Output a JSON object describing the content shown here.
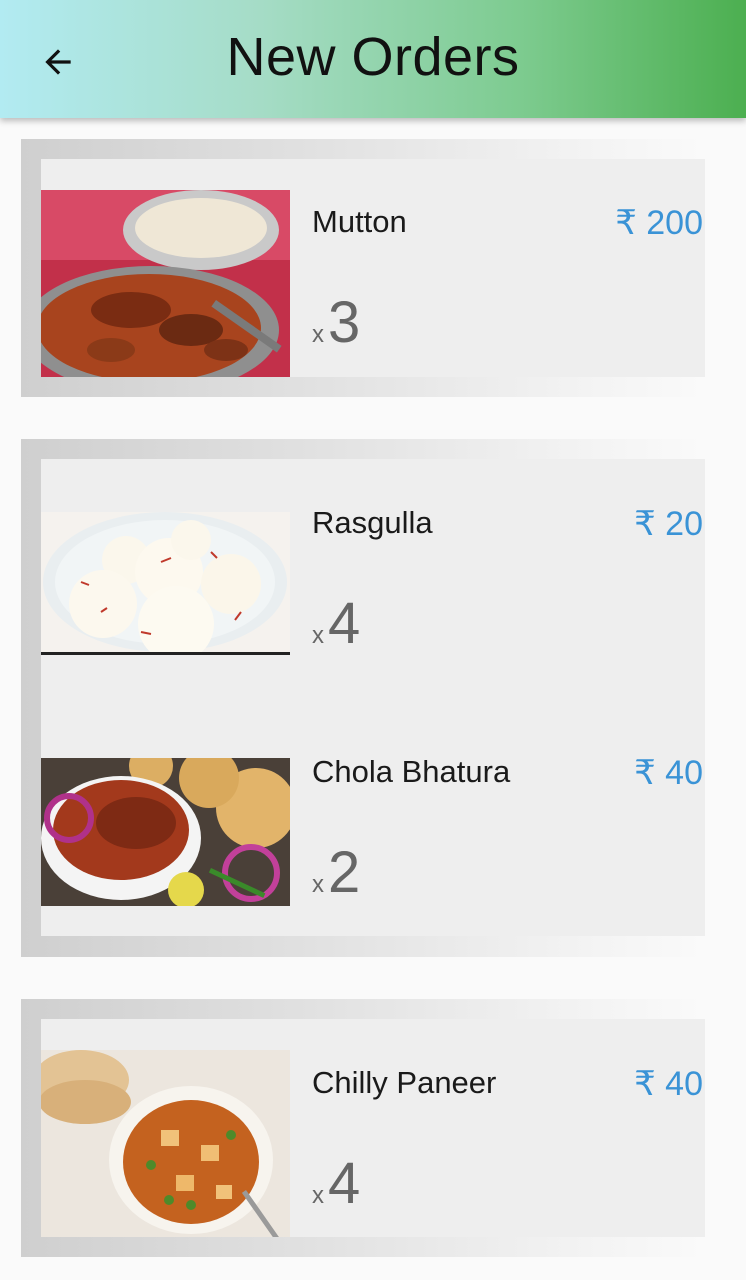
{
  "header": {
    "title": "New Orders",
    "back_icon": "arrow-left-icon"
  },
  "currency_symbol": "₹",
  "orders": [
    {
      "items": [
        {
          "name": "Mutton",
          "price": "₹ 200",
          "qty_prefix": "x",
          "qty": "3",
          "image": "mutton-curry"
        }
      ]
    },
    {
      "items": [
        {
          "name": "Rasgulla",
          "price": "₹ 20",
          "qty_prefix": "x",
          "qty": "4",
          "image": "rasgulla-bowl"
        },
        {
          "name": "Chola Bhatura",
          "price": "₹ 40",
          "qty_prefix": "x",
          "qty": "2",
          "image": "chola-bhatura"
        }
      ]
    },
    {
      "items": [
        {
          "name": "Chilly Paneer",
          "price": "₹ 40",
          "qty_prefix": "x",
          "qty": "4",
          "image": "chilly-paneer"
        }
      ]
    }
  ]
}
